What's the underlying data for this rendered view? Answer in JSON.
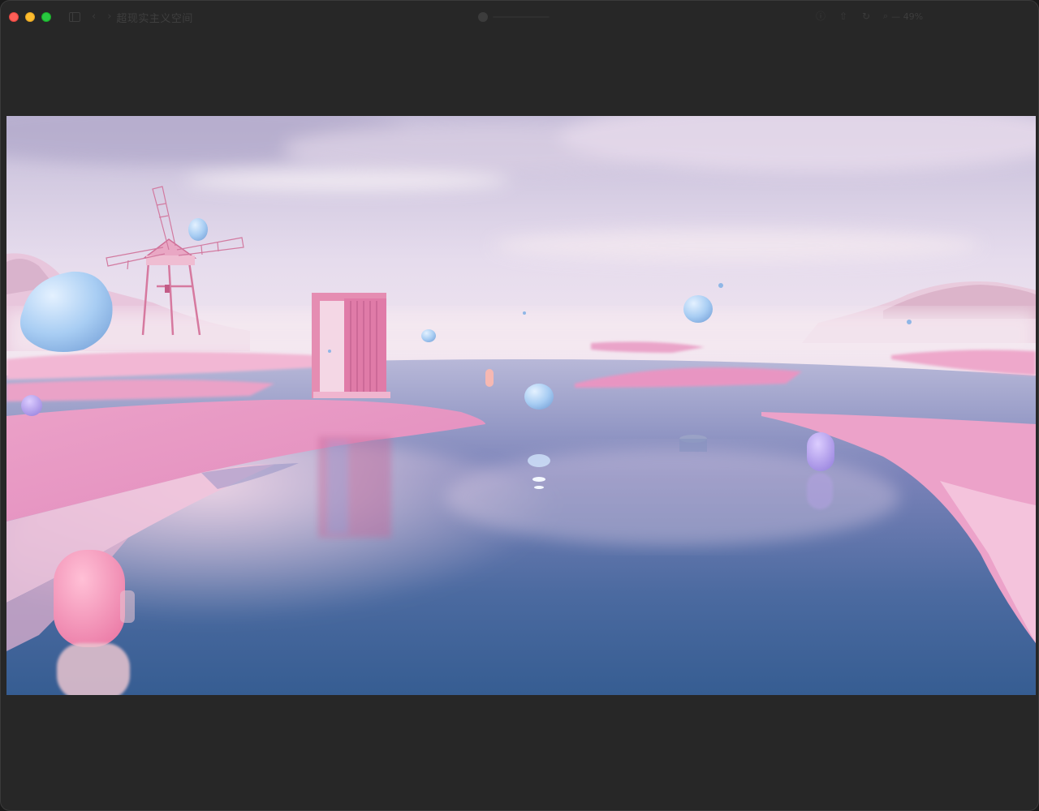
{
  "window": {
    "title": "超现实主义空间",
    "zoom_label": "— 49%"
  },
  "toolbar": {
    "sidebar_icon": "sidebar-icon",
    "back_icon": "chevron-left-icon",
    "forward_icon": "chevron-right-icon",
    "info_icon": "info-icon",
    "share_icon": "share-icon",
    "rotate_icon": "rotate-icon",
    "zoom_icon": "magnifier-icon"
  },
  "colors": {
    "window_bg": "#272727",
    "close": "#fe5f57",
    "minimize": "#febc2e",
    "zoom": "#28c840",
    "sky_top": "#c9c2dd",
    "water_deep": "#3d5e93",
    "grass_pink": "#e88fbd"
  }
}
